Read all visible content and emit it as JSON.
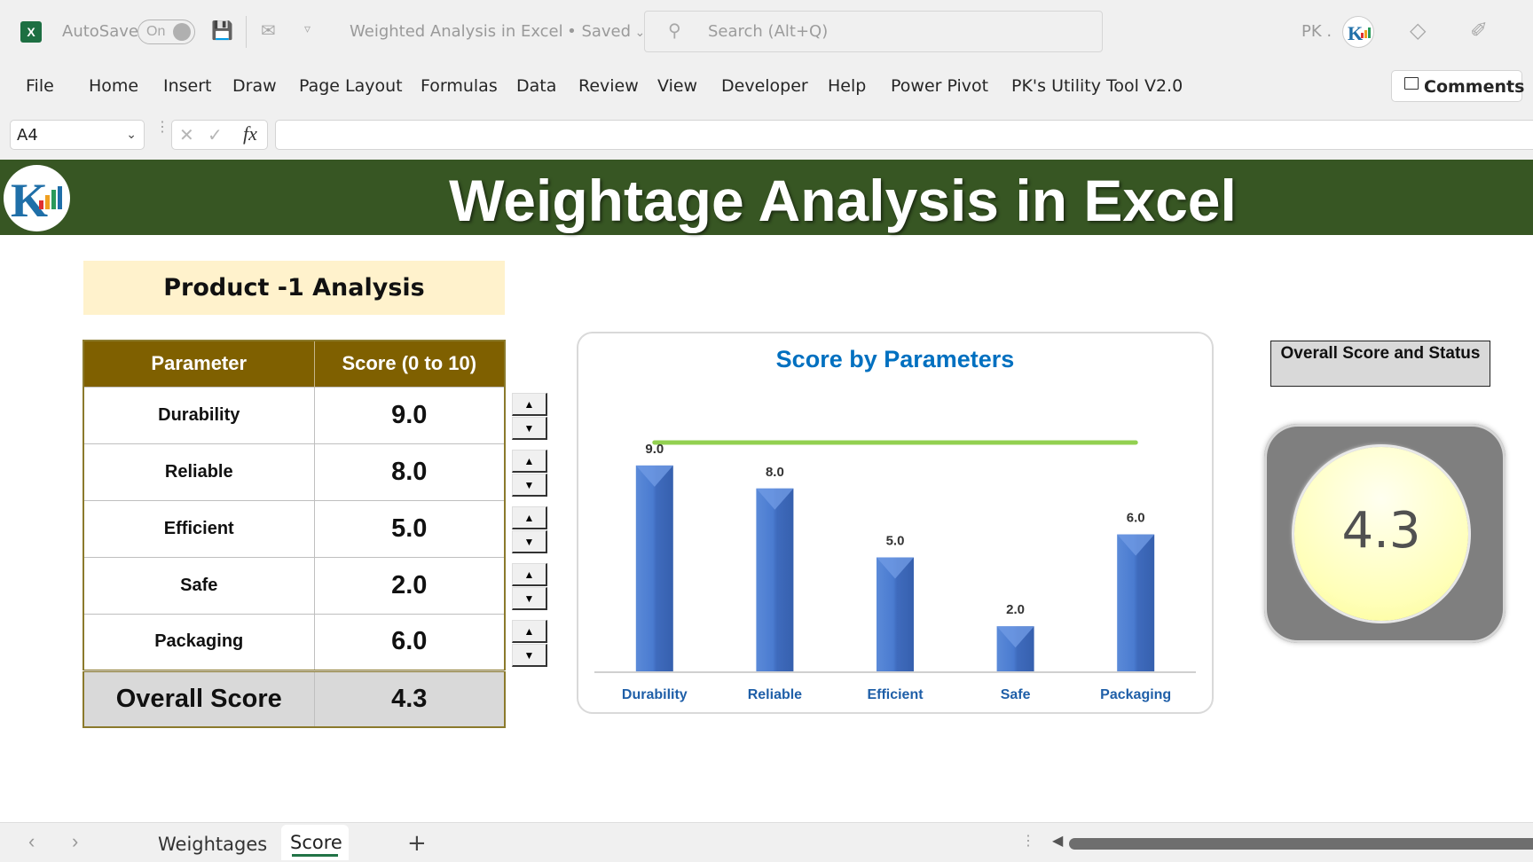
{
  "titlebar": {
    "autosave_label": "AutoSave",
    "autosave_state": "On",
    "doc_title": "Weighted Analysis in Excel",
    "save_status": "Saved",
    "search_placeholder": "Search (Alt+Q)",
    "user_initials": "PK ."
  },
  "ribbon": {
    "tabs": [
      "File",
      "Home",
      "Insert",
      "Draw",
      "Page Layout",
      "Formulas",
      "Data",
      "Review",
      "View",
      "Developer",
      "Help",
      "Power Pivot",
      "PK's Utility Tool V2.0"
    ],
    "comments_label": "Comments"
  },
  "formula_bar": {
    "name_box": "A4",
    "fx_label": "fx",
    "formula": ""
  },
  "sheet": {
    "banner_title": "Weightage Analysis in Excel",
    "product_title": "Product -1 Analysis",
    "table": {
      "headers": [
        "Parameter",
        "Score (0 to 10)"
      ],
      "rows": [
        {
          "parameter": "Durability",
          "score": "9.0"
        },
        {
          "parameter": "Reliable",
          "score": "8.0"
        },
        {
          "parameter": "Efficient",
          "score": "5.0"
        },
        {
          "parameter": "Safe",
          "score": "2.0"
        },
        {
          "parameter": "Packaging",
          "score": "6.0"
        }
      ],
      "total_label": "Overall Score",
      "total_value": "4.3"
    },
    "status_label": "Overall Score and Status",
    "gauge_value": "4.3",
    "gauge_colors": {
      "frame": "#7f7f7f",
      "fill": "#ffffb8"
    }
  },
  "chart_data": {
    "type": "bar",
    "title": "Score by Parameters",
    "categories": [
      "Durability",
      "Reliable",
      "Efficient",
      "Safe",
      "Packaging"
    ],
    "values": [
      9.0,
      8.0,
      5.0,
      2.0,
      6.0
    ],
    "data_labels": [
      "9.0",
      "8.0",
      "5.0",
      "2.0",
      "6.0"
    ],
    "target_line": {
      "value": 10,
      "color": "#92d050"
    },
    "bar_color": "#4472c4",
    "title_color": "#0070c0",
    "xlabel": "",
    "ylabel": "",
    "ylim": [
      0,
      10
    ],
    "grid": false,
    "legend": "none"
  },
  "sheets": {
    "tabs": [
      "Weightages",
      "Score"
    ],
    "active": "Score",
    "add_label": "+"
  }
}
